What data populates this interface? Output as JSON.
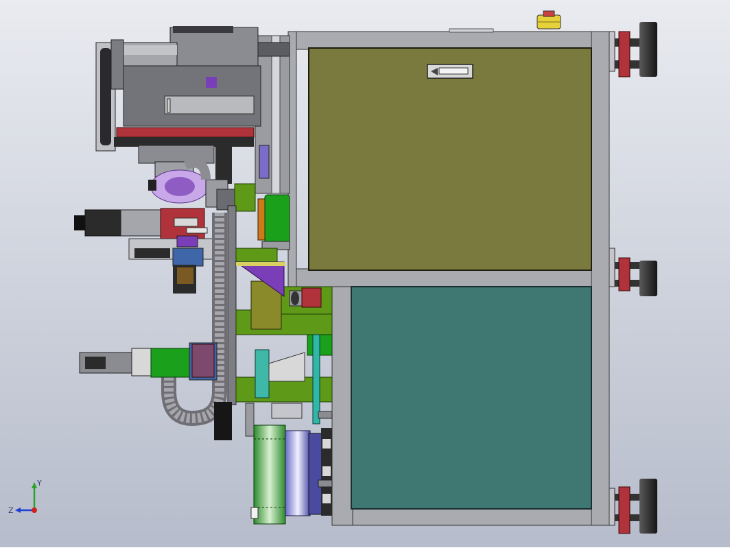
{
  "viewport": {
    "background_top": "#e9ebf0",
    "background_bottom": "#b6bccb"
  },
  "triad": {
    "x_label": "Z",
    "y_label": "Y",
    "colors": {
      "y": "#2aa32a",
      "z": "#1f3fd0",
      "origin": "#cc2222"
    }
  },
  "model_colors": {
    "frame": "#a9abb0",
    "olive_panel": "#7a7a3e",
    "teal_panel": "#3f7773",
    "lime": "#5e9a18",
    "bright_green": "#1aa01a",
    "cable_chain": "#8c8c92",
    "motor_dark": "#2b2b2b",
    "red_parts": "#b0323a",
    "purple_parts": "#7a3fb8",
    "yellow_cap": "#e7d13a"
  },
  "icons": [
    "handle-icon",
    "coordinate-triad-icon"
  ]
}
